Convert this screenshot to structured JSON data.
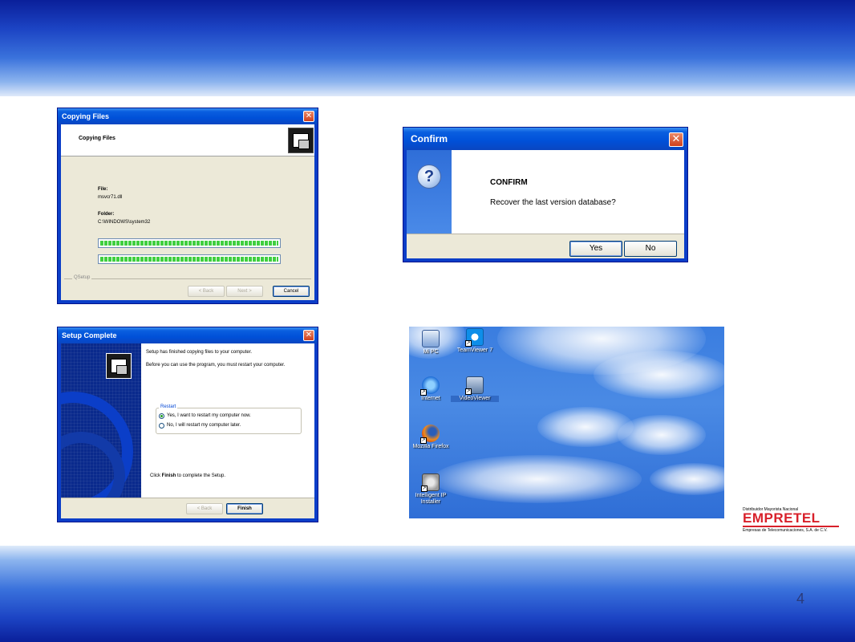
{
  "slide": {
    "page_number": "4"
  },
  "copying_window": {
    "title": "Copying Files",
    "header_title": "Copying Files",
    "file_label": "File:",
    "file_value": "msvcr71.dll",
    "folder_label": "Folder:",
    "folder_value": "C:\\WINDOWS\\system32",
    "progress_1": 1.0,
    "progress_2": 1.0,
    "footer_label": "QSetup",
    "back_label": "< Back",
    "next_label": "Next >",
    "cancel_label": "Cancel",
    "close_glyph": "✕"
  },
  "confirm_window": {
    "title": "Confirm",
    "heading": "CONFIRM",
    "message": "Recover the last version database?",
    "yes_label": "Yes",
    "no_label": "No",
    "question_glyph": "?",
    "close_glyph": "✕"
  },
  "setup_complete_window": {
    "title": "Setup Complete",
    "line1": "Setup has finished copying files to your computer.",
    "line2": "Before you can use the program, you must restart your computer.",
    "group_label": "Restart",
    "option_yes": "Yes, I want to restart my computer now.",
    "option_no": "No, I will restart my computer later.",
    "finish_text_pre": "Click ",
    "finish_text_bold": "Finish",
    "finish_text_post": " to complete the Setup.",
    "back_label": "< Back",
    "finish_label": "Finish",
    "close_glyph": "✕"
  },
  "desktop": {
    "icons": [
      {
        "label": "Mi PC",
        "icon": "computer-icon"
      },
      {
        "label": "TeamViewer 7",
        "icon": "teamviewer-icon"
      },
      {
        "label": "Internet",
        "icon": "internet-explorer-icon"
      },
      {
        "label": "VideoViewer",
        "icon": "videoviewer-icon"
      },
      {
        "label": "Mozilla Firefox",
        "icon": "firefox-icon"
      },
      {
        "label": "Intelligent IP Installer",
        "icon": "ip-installer-icon"
      }
    ]
  },
  "logo": {
    "tagline": "Distribuidor Mayorista Nacional",
    "name": "EMPRETEL",
    "subtitle": "Empresas de Telecomunicaciones, S.A. de C.V.",
    "brand_color": "#d8202a"
  },
  "colors": {
    "xp_title_blue": "#0050d8",
    "xp_face": "#ece9d8",
    "progress_green": "#3fcf3f"
  }
}
